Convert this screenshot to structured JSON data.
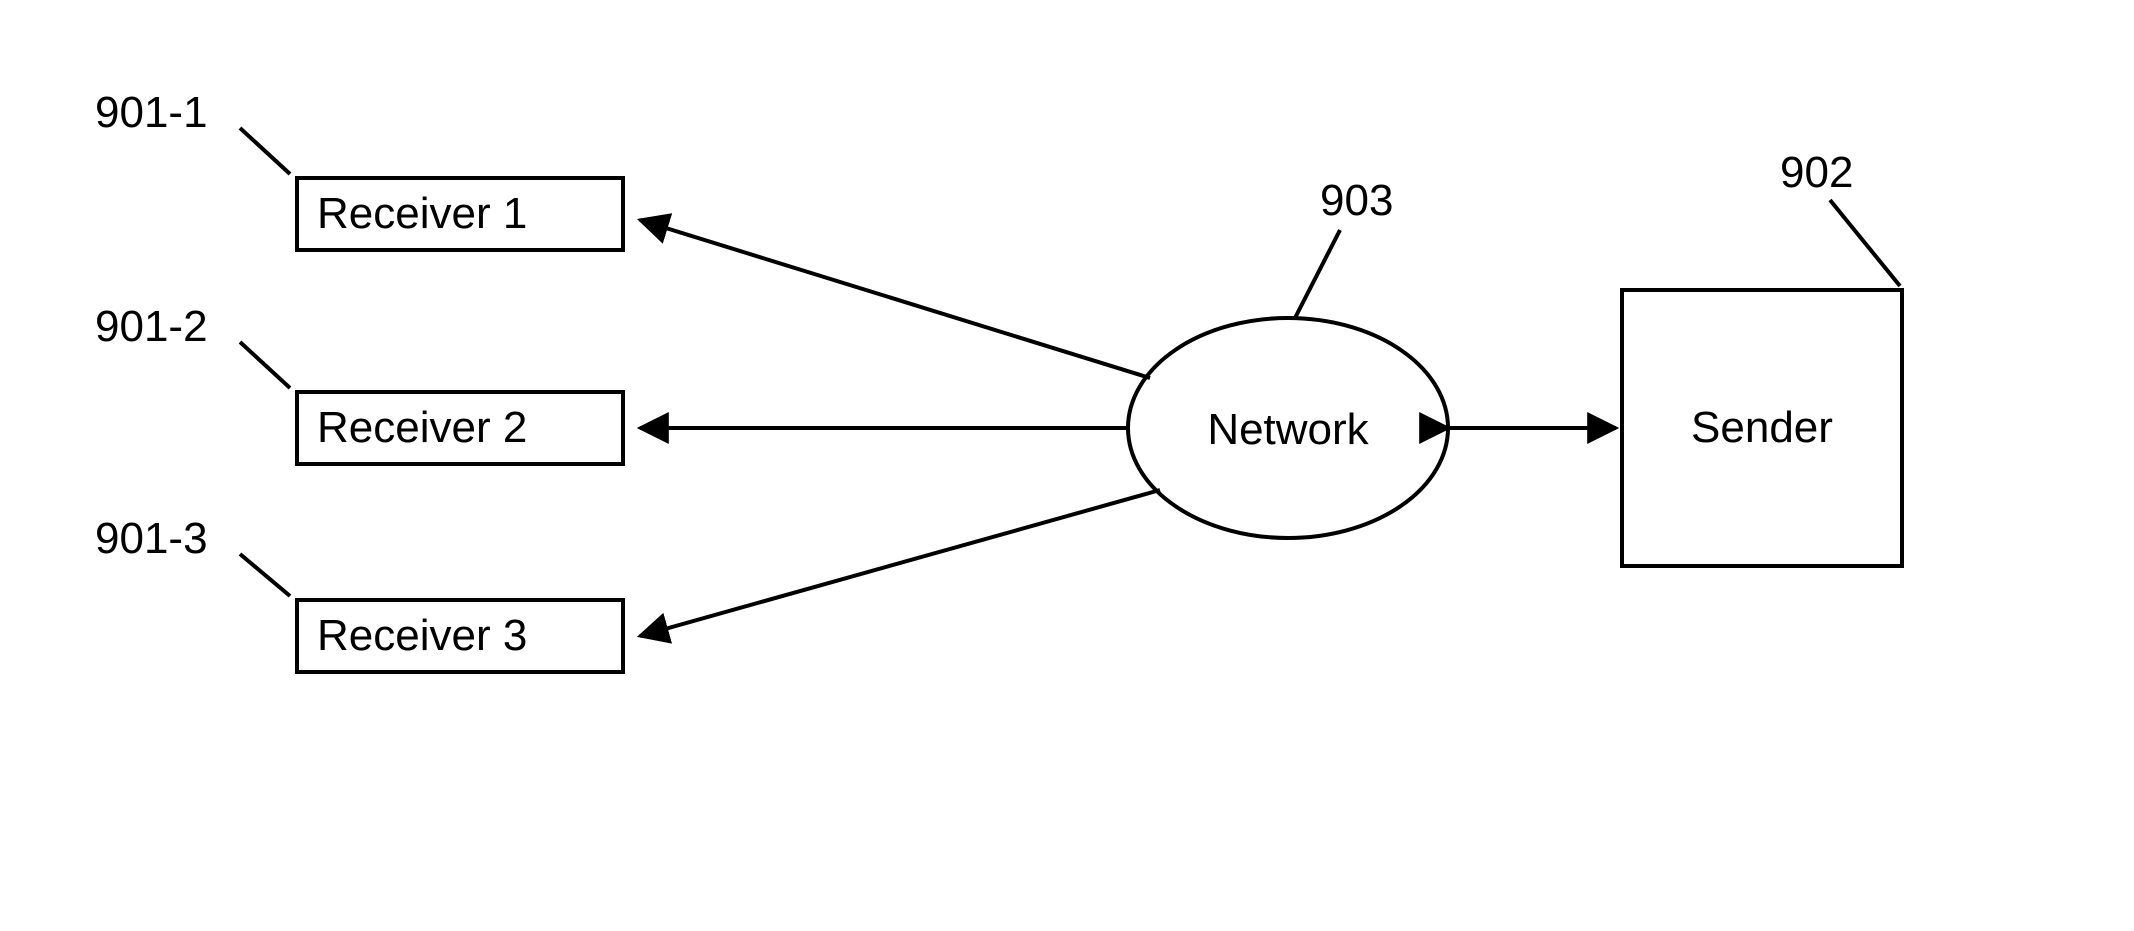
{
  "labels": {
    "ref1": "901-1",
    "ref2": "901-2",
    "ref3": "901-3",
    "ref_network": "903",
    "ref_sender": "902"
  },
  "nodes": {
    "receiver1": "Receiver 1",
    "receiver2": "Receiver 2",
    "receiver3": "Receiver 3",
    "network": "Network",
    "sender": "Sender"
  }
}
